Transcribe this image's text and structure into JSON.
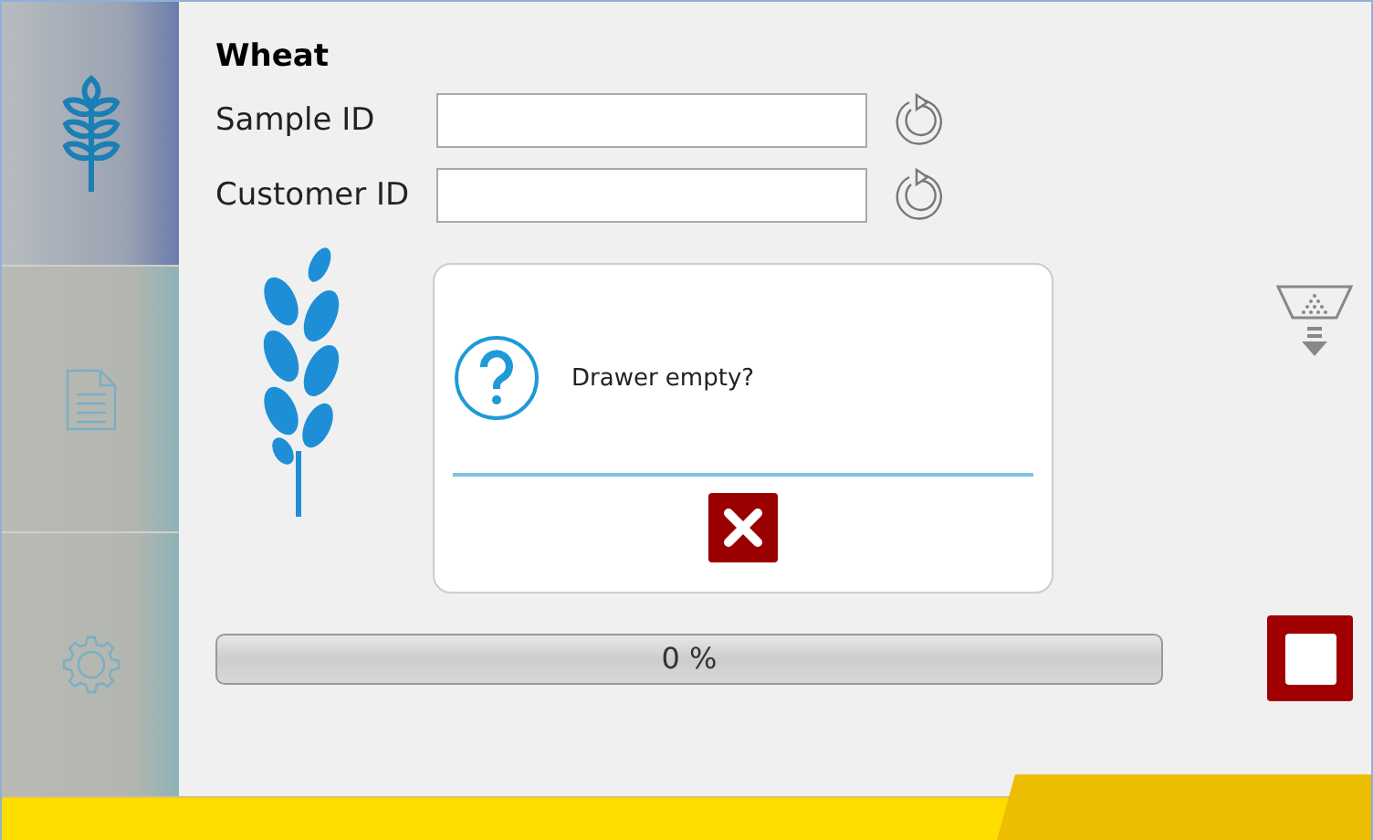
{
  "sidebar": {
    "items": [
      {
        "kind": "wheat",
        "selected": true
      },
      {
        "kind": "document",
        "selected": false
      },
      {
        "kind": "settings",
        "selected": false
      }
    ]
  },
  "sample": {
    "title": "Wheat",
    "fields": [
      {
        "label": "Sample ID"
      },
      {
        "label": "Customer ID"
      }
    ]
  },
  "dialog": {
    "message": "Drawer empty?"
  },
  "progress": {
    "level": 0,
    "reading": "0 %"
  }
}
